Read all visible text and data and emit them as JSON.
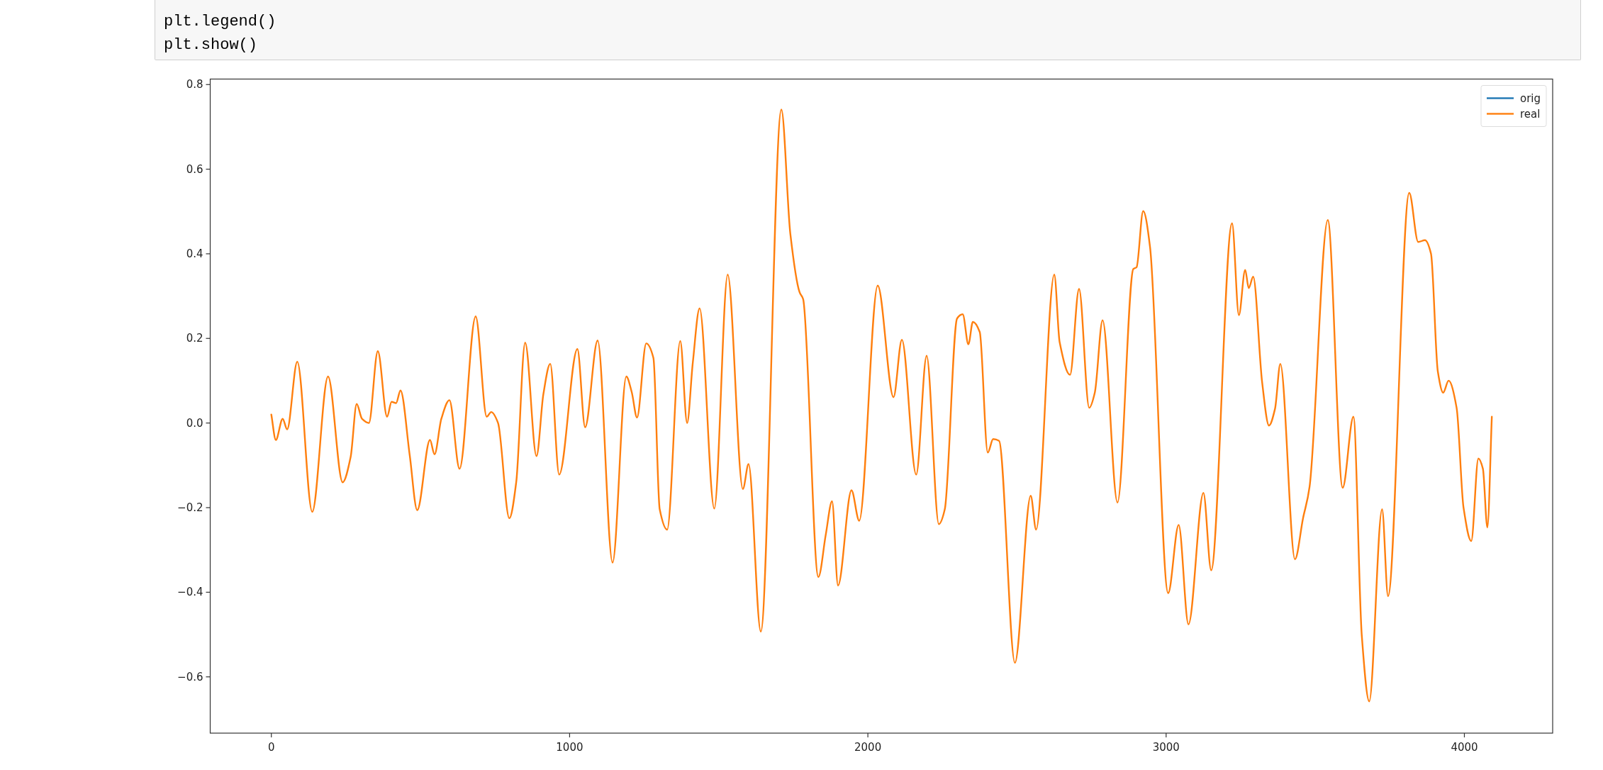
{
  "code_cell": {
    "lines": [
      "plt.legend()",
      "plt.show()"
    ]
  },
  "plot": {
    "chart_data": {
      "type": "line",
      "x": [
        0,
        15,
        38,
        53,
        87,
        137,
        190,
        239,
        266,
        286,
        304,
        327,
        357,
        388,
        403,
        418,
        433,
        464,
        489,
        532,
        547,
        570,
        597,
        631,
        685,
        722,
        737,
        760,
        798,
        821,
        851,
        889,
        912,
        935,
        965,
        1026,
        1052,
        1094,
        1144,
        1190,
        1208,
        1226,
        1257,
        1281,
        1302,
        1327,
        1371,
        1394,
        1413,
        1436,
        1485,
        1530,
        1581,
        1600,
        1641,
        1710,
        1740,
        1771,
        1783,
        1834,
        1859,
        1880,
        1900,
        1945,
        1971,
        2033,
        2086,
        2114,
        2162,
        2197,
        2238,
        2258,
        2299,
        2318,
        2337,
        2352,
        2375,
        2402,
        2420,
        2440,
        2493,
        2546,
        2564,
        2625,
        2643,
        2678,
        2708,
        2742,
        2761,
        2787,
        2837,
        2890,
        2901,
        2923,
        2946,
        3007,
        3042,
        3075,
        3125,
        3151,
        3221,
        3244,
        3265,
        3277,
        3292,
        3322,
        3345,
        3365,
        3383,
        3432,
        3459,
        3481,
        3542,
        3592,
        3628,
        3656,
        3681,
        3724,
        3744,
        3815,
        3845,
        3868,
        3888,
        3911,
        3929,
        3947,
        3974,
        3997,
        4023,
        4047,
        4062,
        4077,
        4092
      ],
      "series": [
        {
          "name": "orig",
          "color": "#1f77b4",
          "values": [
            null,
            null,
            null,
            null,
            null,
            null,
            null,
            null,
            null,
            null,
            null,
            null,
            null,
            null,
            null,
            null,
            null,
            null,
            null,
            null,
            null,
            null,
            null,
            null,
            null,
            null,
            null,
            null,
            null,
            null,
            null,
            null,
            null,
            null,
            null,
            null,
            null,
            null,
            null,
            null,
            null,
            null,
            null,
            null,
            null,
            null,
            null,
            null,
            null,
            null,
            null,
            null,
            null,
            null,
            null,
            null,
            null,
            null,
            null,
            null,
            null,
            null,
            null,
            null,
            null,
            null,
            null,
            null,
            null,
            null,
            null,
            null,
            null,
            null,
            null,
            null,
            null,
            null,
            null,
            null,
            null,
            null,
            null,
            null,
            null,
            null,
            null,
            null,
            null,
            null,
            null,
            null,
            null,
            null,
            null,
            null,
            null,
            null,
            null,
            null,
            null,
            null,
            null,
            null,
            null,
            null,
            null,
            null,
            null,
            null,
            null,
            null,
            null,
            null,
            null,
            null,
            null,
            null,
            null,
            null,
            null,
            null,
            null,
            null,
            null,
            null,
            null,
            null,
            null,
            null,
            null,
            null,
            null
          ]
        },
        {
          "name": "real",
          "color": "#ff7f0e",
          "values": [
            0.02,
            -0.04,
            0.01,
            -0.015,
            0.145,
            -0.21,
            0.11,
            -0.14,
            -0.08,
            0.045,
            0.01,
            0,
            0.17,
            0.015,
            0.05,
            0.047,
            0.077,
            -0.076,
            -0.206,
            -0.04,
            -0.074,
            0.01,
            0.054,
            -0.108,
            0.252,
            0.015,
            0.026,
            0,
            -0.225,
            -0.14,
            0.19,
            -0.078,
            0.068,
            0.14,
            -0.122,
            0.175,
            -0.01,
            0.195,
            -0.33,
            0.11,
            0.074,
            0.013,
            0.188,
            0.154,
            -0.204,
            -0.252,
            0.194,
            0,
            0.143,
            0.271,
            -0.202,
            0.351,
            -0.156,
            -0.097,
            -0.493,
            0.741,
            0.448,
            0.309,
            0.293,
            -0.364,
            -0.263,
            -0.185,
            -0.384,
            -0.159,
            -0.231,
            0.325,
            0.061,
            0.197,
            -0.122,
            0.159,
            -0.239,
            -0.204,
            0.247,
            0.257,
            0.186,
            0.239,
            0.215,
            -0.07,
            -0.038,
            -0.042,
            -0.567,
            -0.172,
            -0.252,
            0.351,
            0.191,
            0.114,
            0.317,
            0.036,
            0.072,
            0.243,
            -0.188,
            0.364,
            0.368,
            0.501,
            0.416,
            -0.402,
            -0.241,
            -0.476,
            -0.165,
            -0.348,
            0.472,
            0.255,
            0.362,
            0.319,
            0.346,
            0.095,
            -0.006,
            0.033,
            0.14,
            -0.322,
            -0.225,
            -0.151,
            0.48,
            -0.153,
            0.015,
            -0.503,
            -0.658,
            -0.204,
            -0.409,
            0.544,
            0.428,
            0.432,
            0.4,
            0.122,
            0.072,
            0.1,
            0.036,
            -0.199,
            -0.279,
            -0.084,
            -0.108,
            -0.247,
            0.015
          ]
        }
      ],
      "legend": true,
      "xlim": [
        -205,
        4296
      ],
      "ylim": [
        -0.733,
        0.813
      ],
      "xticks": [
        0,
        1000,
        2000,
        3000,
        4000
      ],
      "yticks": [
        {
          "value": -0.6,
          "label": "−0.6"
        },
        {
          "value": -0.4,
          "label": "−0.4"
        },
        {
          "value": -0.2,
          "label": "−0.2"
        },
        {
          "value": 0,
          "label": "0.0"
        },
        {
          "value": 0.2,
          "label": "0.2"
        },
        {
          "value": 0.4,
          "label": "0.4"
        },
        {
          "value": 0.6,
          "label": "0.6"
        },
        {
          "value": 0.8,
          "label": "0.8"
        }
      ]
    }
  }
}
